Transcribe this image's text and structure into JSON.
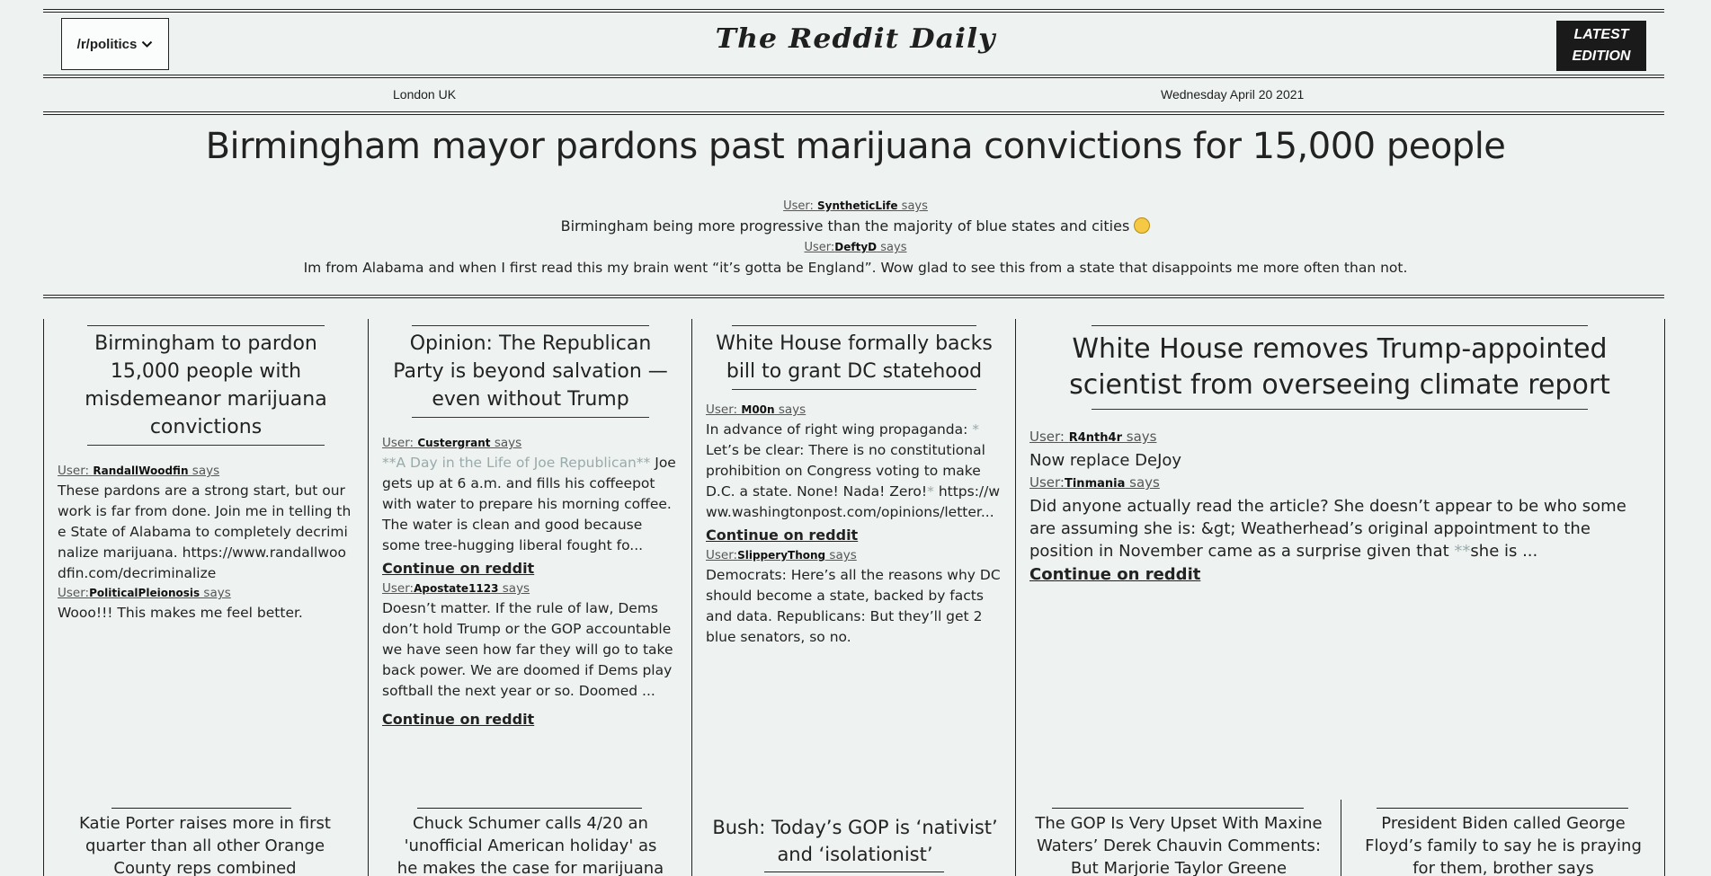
{
  "header": {
    "subreddit": "/r/politics",
    "brand": "The Reddit Daily",
    "latest_line1": "LATEST",
    "latest_line2": "EDITION",
    "location": "London UK",
    "date": "Wednesday April 20 2021"
  },
  "hero": {
    "title": "Birmingham mayor pardons past marijuana convictions for 15,000 people",
    "comments": [
      {
        "prefix": "User: ",
        "user": "SyntheticLife",
        "says": " says",
        "text": "Birmingham being more progressive than the majority of blue states and cities"
      },
      {
        "prefix": "User:",
        "user": "DeftyD",
        "says": " says",
        "text": "Im from Alabama and when I first read this my brain went “it’s gotta be England”. Wow glad to see this from a state that disappoints me more often than not."
      }
    ]
  },
  "columns": [
    {
      "title": "Birmingham to pardon 15,000 people with misdemeanor marijuana convictions",
      "comments": [
        {
          "prefix": "User: ",
          "user": "RandallWoodfin",
          "says": " says",
          "text": "These pardons are a strong start, but our work is far from done. Join me in telling the State of Alabama to completely decriminalize marijuana. https://www.randallwoodfin.com/decriminalize"
        },
        {
          "prefix": "User:",
          "user": "PoliticalPleionosis",
          "says": " says",
          "text": "Wooo!!! This makes me feel better."
        }
      ],
      "bottom_title": "Katie Porter raises more in first quarter than all other Orange County reps combined"
    },
    {
      "title": "Opinion: The Republican Party is beyond salvation — even without Trump",
      "comments": [
        {
          "prefix": "User: ",
          "user": "Custergrant",
          "says": " says",
          "text_faint": "**A Day in the Life of Joe Republican**",
          "text": "Joe gets up at 6 a.m. and fills his coffeepot with water to prepare his morning coffee. The water is clean and good because some tree-hugging liberal fought fo...",
          "more": "Continue on reddit"
        },
        {
          "prefix": "User:",
          "user": "Apostate1123",
          "says": " says",
          "text": "Doesn’t matter. If the rule of law, Dems don’t hold Trump or the GOP accountable we have seen how far they will go to take back power. We are doomed if Dems play softball the next year or so. Doomed ...",
          "more": "Continue on reddit"
        }
      ],
      "bottom_title": "Chuck Schumer calls 4/20 an 'unofficial American holiday' as he makes the case for marijuana"
    },
    {
      "title": "White House formally backs bill to grant DC statehood",
      "comments": [
        {
          "prefix": "User: ",
          "user": "M00n",
          "says": " says",
          "text_pre": "In advance of right wing propaganda:",
          "text_faint": "*",
          "text": "Let’s be clear: There is no constitutional prohibition on Congress voting to make D.C. a state. None! Nada! Zero!",
          "text_faint2": "*",
          "text_post": "https://www.washingtonpost.com/opinions/letter...",
          "more": "Continue on reddit"
        },
        {
          "prefix": "User:",
          "user": "SlipperyThong",
          "says": " says",
          "text": "Democrats: Here’s all the reasons why DC should become a state, backed by facts and data. Republicans: But they’ll get 2 blue senators, so no."
        }
      ],
      "bottom_title": "Bush: Today’s GOP is ‘nativist’ and ‘isolationist’"
    },
    {
      "title": "White House removes Trump-appointed scientist from overseeing climate report",
      "comments": [
        {
          "prefix": "User: ",
          "user": "R4nth4r",
          "says": " says",
          "text": "Now replace DeJoy"
        },
        {
          "prefix": "User:",
          "user": "Tinmania",
          "says": " says",
          "text": "Did anyone actually read the article? She doesn’t appear to be who some are assuming she is: &gt; Weatherhead’s original appointment to the position in November came as a surprise given that ",
          "text_faint": "**",
          "text_post": "she is ...",
          "more": "Continue on reddit"
        }
      ],
      "bottom_titles": [
        "The GOP Is Very Upset With Maxine Waters’ Derek Chauvin Comments: But Marjorie Taylor Greene endorsing the",
        "President Biden called George Floyd’s family to say he is praying for them, brother says"
      ]
    }
  ]
}
